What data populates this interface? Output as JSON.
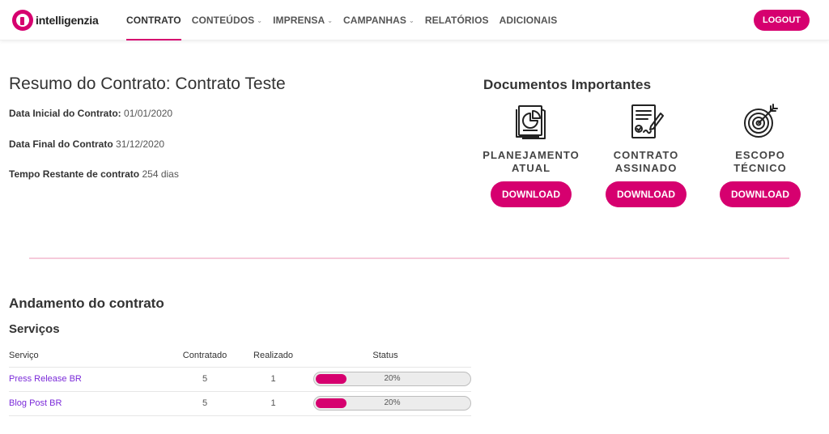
{
  "brand": {
    "name": "intelligenzia",
    "accent": "#d6006f"
  },
  "nav": {
    "items": [
      {
        "label": "CONTRATO",
        "active": true,
        "dropdown": false
      },
      {
        "label": "CONTEÚDOS",
        "active": false,
        "dropdown": true
      },
      {
        "label": "IMPRENSA",
        "active": false,
        "dropdown": true
      },
      {
        "label": "CAMPANHAS",
        "active": false,
        "dropdown": true
      },
      {
        "label": "RELATÓRIOS",
        "active": false,
        "dropdown": false
      },
      {
        "label": "ADICIONAIS",
        "active": false,
        "dropdown": false
      }
    ],
    "logout_label": "LOGOUT"
  },
  "summary": {
    "title": "Resumo do Contrato: Contrato Teste",
    "start_label": "Data Inicial do Contrato:",
    "start_value": "01/01/2020",
    "end_label": "Data Final do Contrato",
    "end_value": "31/12/2020",
    "remaining_label": "Tempo Restante de contrato",
    "remaining_value": "254 dias"
  },
  "documents": {
    "title": "Documentos Importantes",
    "items": [
      {
        "label_line1": "PLANEJAMENTO",
        "label_line2": "ATUAL",
        "icon": "chart-report-icon",
        "button": "DOWNLOAD"
      },
      {
        "label_line1": "CONTRATO",
        "label_line2": "ASSINADO",
        "icon": "signed-contract-icon",
        "button": "DOWNLOAD"
      },
      {
        "label_line1": "ESCOPO",
        "label_line2": "TÉCNICO",
        "icon": "target-icon",
        "button": "DOWNLOAD"
      }
    ]
  },
  "progress": {
    "title": "Andamento do contrato",
    "services_title": "Serviços",
    "columns": [
      "Serviço",
      "Contratado",
      "Realizado",
      "Status"
    ],
    "rows": [
      {
        "service": "Press Release BR",
        "contracted": "5",
        "done": "1",
        "status": "20%",
        "status_fraction": 0.2
      },
      {
        "service": "Blog Post BR",
        "contracted": "5",
        "done": "1",
        "status": "20%",
        "status_fraction": 0.2
      }
    ]
  }
}
